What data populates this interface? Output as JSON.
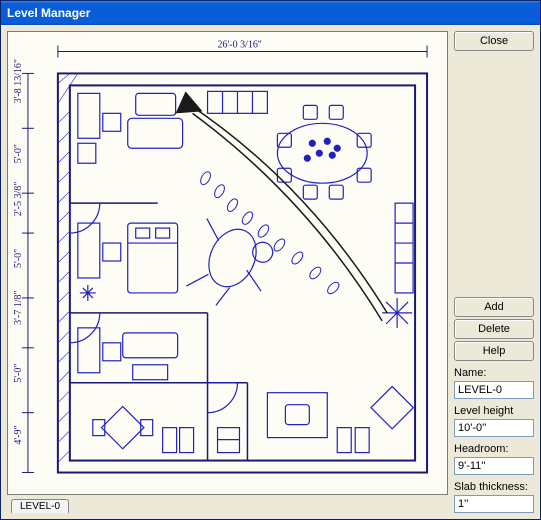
{
  "window": {
    "title": "Level Manager"
  },
  "buttons": {
    "close": "Close",
    "add": "Add",
    "delete": "Delete",
    "help": "Help"
  },
  "labels": {
    "name": "Name:",
    "level_height": "Level height",
    "headroom": "Headroom:",
    "slab": "Slab thickness:"
  },
  "fields": {
    "name": "LEVEL-0",
    "level_height": "10'-0''",
    "headroom": "9'-11''",
    "slab": "1''"
  },
  "tab": {
    "label": "LEVEL-0"
  },
  "dims": {
    "top": "26'-0 3/16\"",
    "left": [
      "3'-8 13/16\"",
      "5'-0\"",
      "2'-5 3/8\"",
      "5'-0\"",
      "3'-7 1/8\"",
      "5'-0\"",
      "4'-9\""
    ]
  }
}
